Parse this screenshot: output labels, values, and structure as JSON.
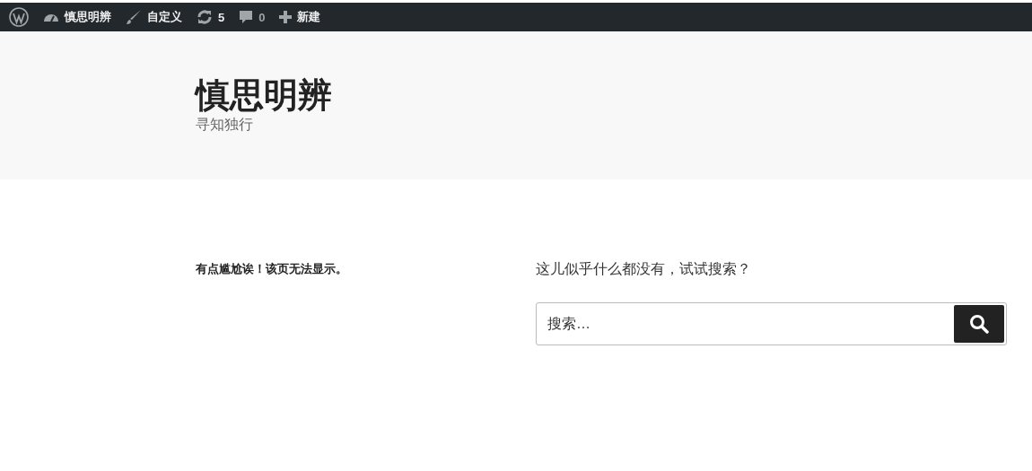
{
  "admin_bar": {
    "items": [
      {
        "kind": "logo"
      },
      {
        "kind": "site",
        "label": "慎思明辨"
      },
      {
        "kind": "customize",
        "label": "自定义"
      },
      {
        "kind": "updates",
        "label": "5"
      },
      {
        "kind": "comments",
        "label": "0"
      },
      {
        "kind": "new",
        "label": "新建"
      }
    ]
  },
  "header": {
    "site_title": "慎思明辨",
    "tagline": "寻知独行"
  },
  "content": {
    "page_title": "有点尴尬诶！该页无法显示。",
    "message": "这儿似乎什么都没有，试试搜索？",
    "search": {
      "placeholder": "搜索…"
    }
  }
}
